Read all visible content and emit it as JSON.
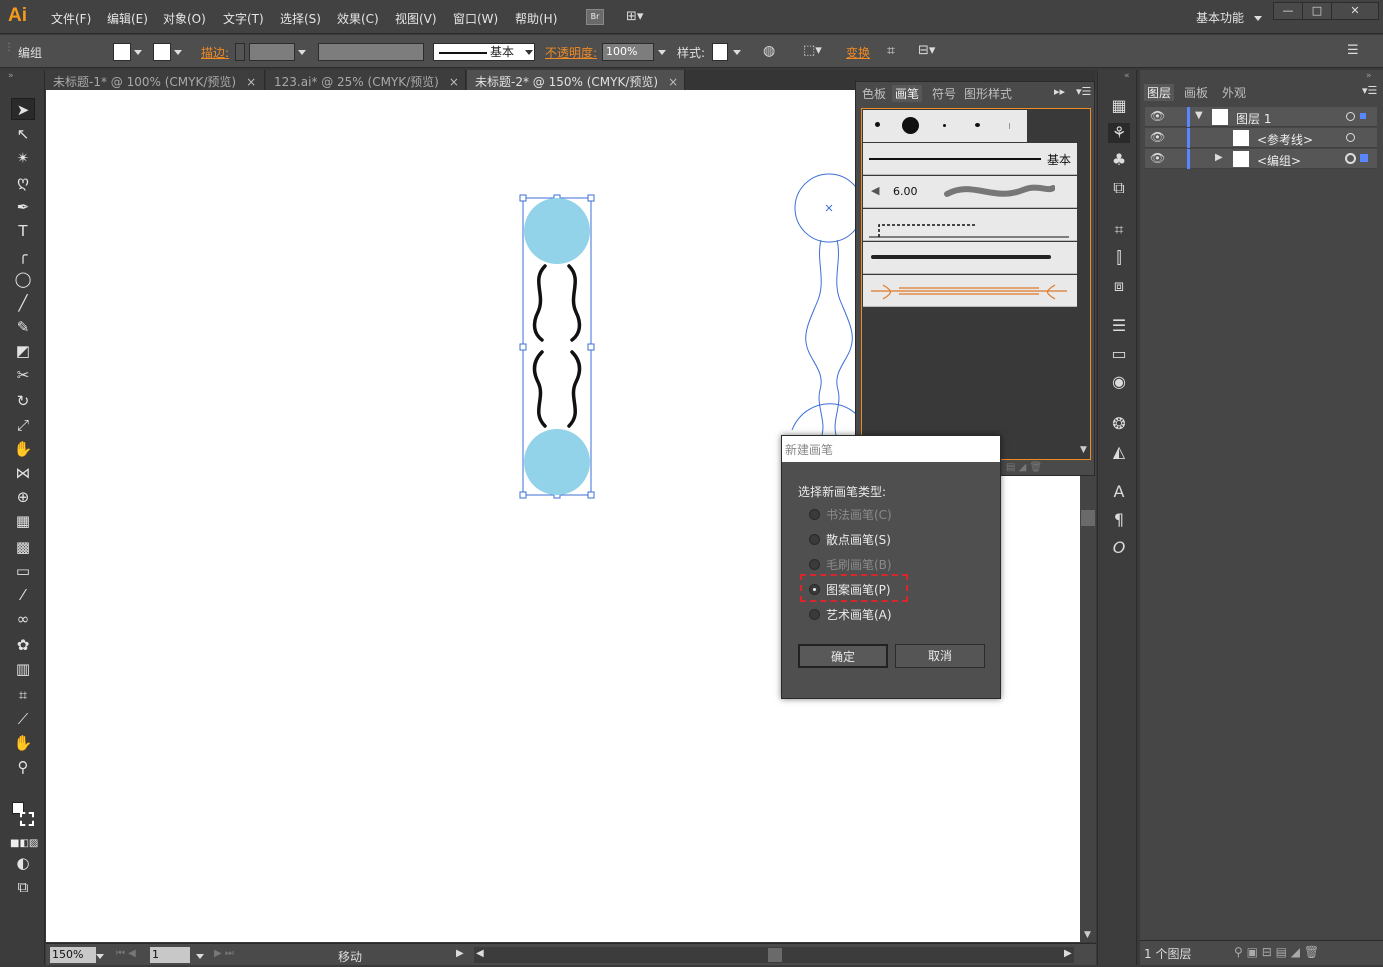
{
  "app": {
    "logo": "Ai",
    "workspace": "基本功能",
    "menu": [
      "文件(F)",
      "编辑(E)",
      "对象(O)",
      "文字(T)",
      "选择(S)",
      "效果(C)",
      "视图(V)",
      "窗口(W)",
      "帮助(H)"
    ],
    "bridge_label": "Br",
    "window_controls": [
      "—",
      "□",
      "✕"
    ]
  },
  "control_bar": {
    "selection_label": "编组",
    "stroke_label": "描边:",
    "brush_name": "基本",
    "opacity_label": "不透明度:",
    "opacity_value": "100%",
    "style_label": "样式:",
    "transform_label": "变换"
  },
  "doc_tabs": [
    {
      "label": "未标题-1* @ 100% (CMYK/预览)",
      "close": "×"
    },
    {
      "label": "123.ai* @ 25% (CMYK/预览)",
      "close": "×"
    },
    {
      "label": "未标题-2* @ 150% (CMYK/预览)",
      "close": "×",
      "active": true
    }
  ],
  "brush_panel": {
    "tabs": [
      "色板",
      "画笔",
      "符号",
      "图形样式"
    ],
    "active_tab": "画笔",
    "basic_label": "基本",
    "calligraphic_size": "6.00"
  },
  "dialog": {
    "title": "新建画笔",
    "prompt": "选择新画笔类型:",
    "options": [
      {
        "label": "书法画笔(C)",
        "enabled": false,
        "checked": false
      },
      {
        "label": "散点画笔(S)",
        "enabled": true,
        "checked": false
      },
      {
        "label": "毛刷画笔(B)",
        "enabled": false,
        "checked": false
      },
      {
        "label": "图案画笔(P)",
        "enabled": true,
        "checked": true
      },
      {
        "label": "艺术画笔(A)",
        "enabled": true,
        "checked": false
      }
    ],
    "ok_label": "确定",
    "cancel_label": "取消"
  },
  "layers_panel": {
    "tabs": [
      "图层",
      "画板",
      "外观"
    ],
    "active_tab": "图层",
    "rows": [
      {
        "name": "图层 1"
      },
      {
        "name": "<参考线>"
      },
      {
        "name": "<编组>"
      }
    ],
    "footer_count": "1 个图层"
  },
  "status_bar": {
    "zoom": "150%",
    "artboard": "1",
    "status": "移动"
  },
  "colors": {
    "accent_orange": "#f08a24",
    "circle_fill": "#93d3ea",
    "selection_blue": "#3b6fd6",
    "highlight_red": "#d9252b",
    "layer_color": "#5a86ff"
  }
}
